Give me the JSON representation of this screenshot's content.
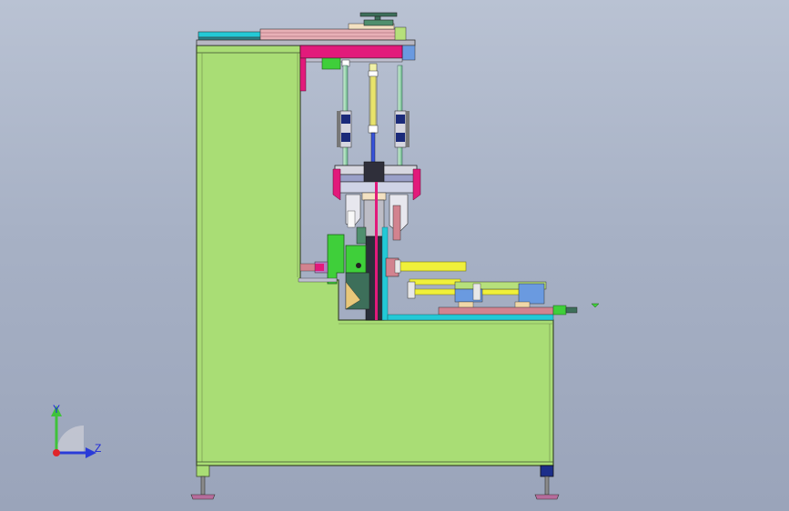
{
  "triad": {
    "x_axis_label": "Z",
    "y_axis_label": "Y"
  },
  "colors": {
    "frame": "#a9dd75",
    "frame_edge": "#3d4a2e",
    "magenta": "#e21a7b",
    "yellow": "#f0f03a",
    "green": "#3fcf3a",
    "blue_plate": "#6a9ae0",
    "dark_blue": "#1b2a7a",
    "cyan": "#23c9d6",
    "pink": "#d2838f"
  }
}
